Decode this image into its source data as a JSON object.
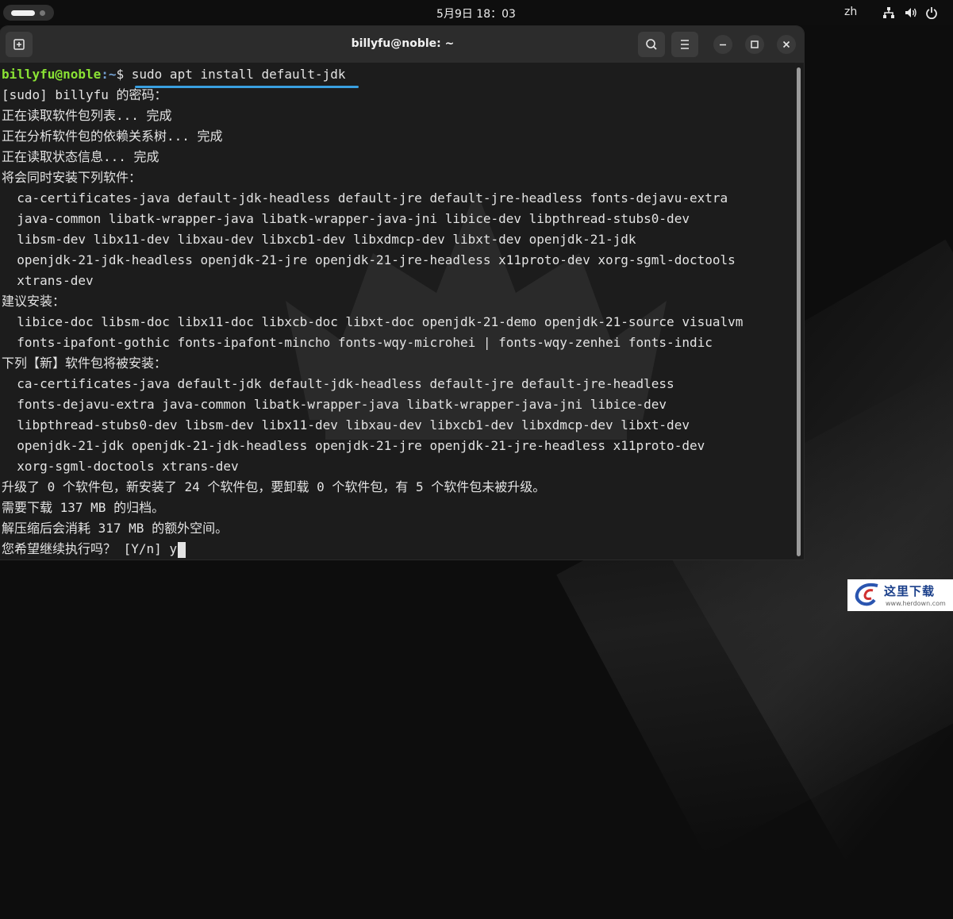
{
  "top_panel": {
    "clock": "5月9日  18：03",
    "input_method": "zh"
  },
  "window": {
    "title": "billyfu@noble: ~"
  },
  "terminal": {
    "prompt_user": "billyfu@noble",
    "prompt_path": ":~",
    "prompt_symbol": "$ ",
    "command": "sudo apt install default-jdk",
    "output": [
      "[sudo] billyfu 的密码：",
      "正在读取软件包列表... 完成",
      "正在分析软件包的依赖关系树... 完成",
      "正在读取状态信息... 完成",
      "将会同时安装下列软件：",
      "  ca-certificates-java default-jdk-headless default-jre default-jre-headless fonts-dejavu-extra",
      "  java-common libatk-wrapper-java libatk-wrapper-java-jni libice-dev libpthread-stubs0-dev",
      "  libsm-dev libx11-dev libxau-dev libxcb1-dev libxdmcp-dev libxt-dev openjdk-21-jdk",
      "  openjdk-21-jdk-headless openjdk-21-jre openjdk-21-jre-headless x11proto-dev xorg-sgml-doctools",
      "  xtrans-dev",
      "建议安装：",
      "  libice-doc libsm-doc libx11-doc libxcb-doc libxt-doc openjdk-21-demo openjdk-21-source visualvm",
      "  fonts-ipafont-gothic fonts-ipafont-mincho fonts-wqy-microhei | fonts-wqy-zenhei fonts-indic",
      "下列【新】软件包将被安装：",
      "  ca-certificates-java default-jdk default-jdk-headless default-jre default-jre-headless",
      "  fonts-dejavu-extra java-common libatk-wrapper-java libatk-wrapper-java-jni libice-dev",
      "  libpthread-stubs0-dev libsm-dev libx11-dev libxau-dev libxcb1-dev libxdmcp-dev libxt-dev",
      "  openjdk-21-jdk openjdk-21-jdk-headless openjdk-21-jre openjdk-21-jre-headless x11proto-dev",
      "  xorg-sgml-doctools xtrans-dev",
      "升级了 0 个软件包，新安装了 24 个软件包，要卸载 0 个软件包，有 5 个软件包未被升级。",
      "需要下载 137 MB 的归档。",
      "解压缩后会消耗 317 MB 的额外空间。"
    ],
    "question": "您希望继续执行吗？ [Y/n] ",
    "answer": "y"
  },
  "site_logo": {
    "text": "这里下载",
    "url": "www.herdown.com"
  }
}
